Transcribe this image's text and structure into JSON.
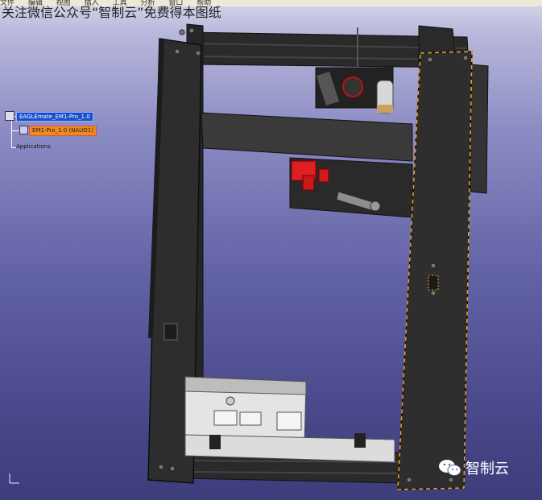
{
  "window": {
    "menu_items": [
      "文件",
      "编辑",
      "视图",
      "插入",
      "工具",
      "分析",
      "窗口",
      "帮助"
    ],
    "watermark_top": "关注微信公众号“智制云”免费得本图纸"
  },
  "spec_tree": {
    "root_label": "EAGLEmate_EM1-Pro_1.0",
    "child_label": "EM1-Pro_1.0 (NAUO1)",
    "applications_label": "Applications"
  },
  "branding": {
    "logo_text": "智制云",
    "logo_icon": "wechat-icon"
  },
  "colors": {
    "frame": "#2b2b2b",
    "selection_dashes": "#f0a020",
    "red_part": "#e02020"
  }
}
